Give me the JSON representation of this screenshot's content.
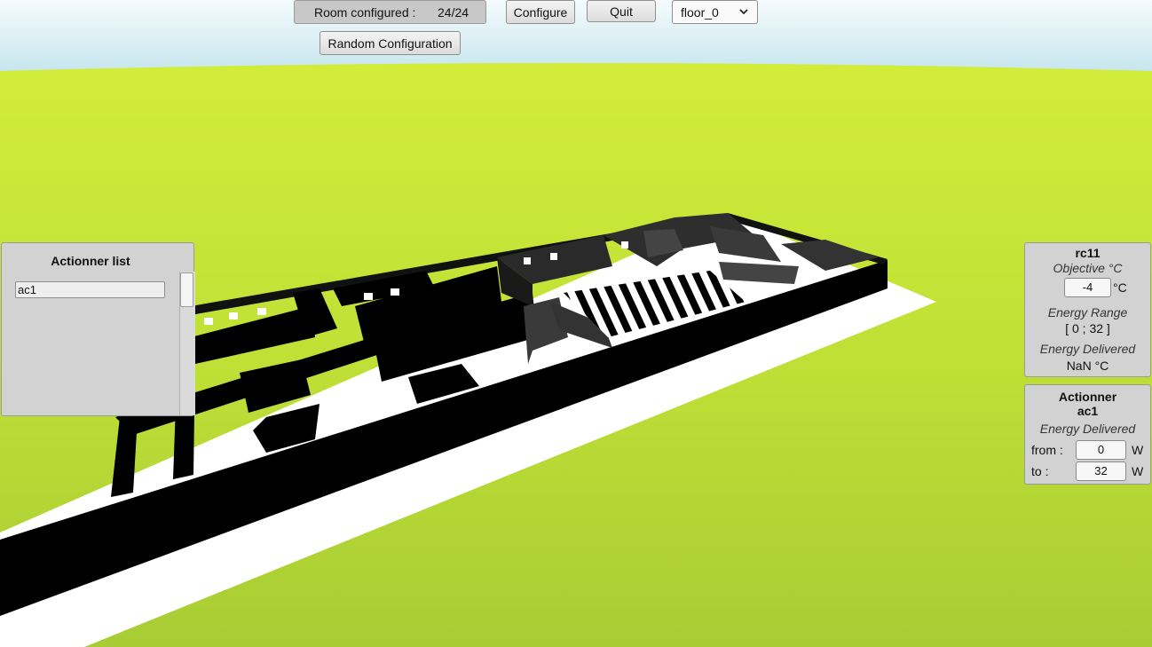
{
  "toolbar": {
    "room_configured_label": "Room configured :",
    "room_configured_value": "24/24",
    "configure_label": "Configure",
    "quit_label": "Quit",
    "floor_selected": "floor_0",
    "random_config_label": "Random Configuration"
  },
  "actionner_list": {
    "title": "Actionner list",
    "items": [
      "ac1"
    ]
  },
  "room_panel": {
    "name": "rc11",
    "objective_label": "Objective °C",
    "objective_value": "-4",
    "objective_unit": "°C",
    "energy_range_label": "Energy Range",
    "energy_range_value": "[ 0 ; 32 ]",
    "energy_delivered_label": "Energy Delivered",
    "energy_delivered_value": "NaN °C"
  },
  "actionner_panel": {
    "title_line1": "Actionner",
    "title_line2": "ac1",
    "energy_delivered_label": "Energy Delivered",
    "from_label": "from :",
    "from_value": "0",
    "from_unit": "W",
    "to_label": "to :",
    "to_value": "32",
    "to_unit": "W"
  },
  "colors": {
    "sky_top": "#ffffff",
    "sky_horizon": "#cfeaf0",
    "grass": "#b7d632",
    "walls": "#000000",
    "floor": "#ffffff"
  }
}
